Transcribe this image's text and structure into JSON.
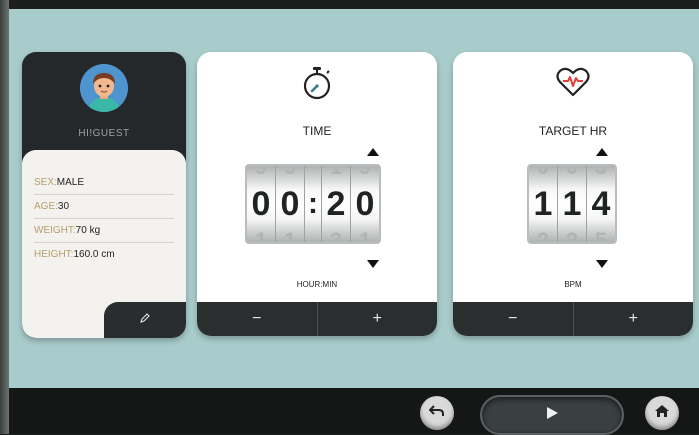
{
  "profile": {
    "greeting": "HI!GUEST",
    "rows": [
      {
        "key": "SEX:",
        "value": "MALE"
      },
      {
        "key": "AGE:",
        "value": "30"
      },
      {
        "key": "WEIGHT:",
        "value": "70 kg"
      },
      {
        "key": "HEIGHT:",
        "value": "160.0 cm"
      }
    ],
    "edit_icon": "pencil-icon"
  },
  "time": {
    "title": "TIME",
    "digits": [
      "0",
      "0",
      ":",
      "2",
      "0"
    ],
    "ghost_top": [
      "9",
      "9",
      "",
      "1",
      "9"
    ],
    "ghost_bottom": [
      "1",
      "1",
      "",
      "3",
      "1"
    ],
    "unit": "HOUR:MIN",
    "minus": "−",
    "plus": "+",
    "icon": "stopwatch-icon"
  },
  "target_hr": {
    "title": "TARGET HR",
    "digits": [
      "1",
      "1",
      "4"
    ],
    "ghost_top": [
      "0",
      "0",
      "3"
    ],
    "ghost_bottom": [
      "2",
      "2",
      "5"
    ],
    "unit": "BPM",
    "minus": "−",
    "plus": "+",
    "icon": "heart-rate-icon"
  },
  "bottom": {
    "back_icon": "back-arrow-icon",
    "play_icon": "play-icon",
    "home_icon": "home-icon"
  },
  "colors": {
    "background": "#a8cccb",
    "card_dark": "#24282a",
    "accent_gold": "#b59e6a",
    "heart_red": "#e0403a",
    "stopwatch_teal": "#2f7f86"
  }
}
